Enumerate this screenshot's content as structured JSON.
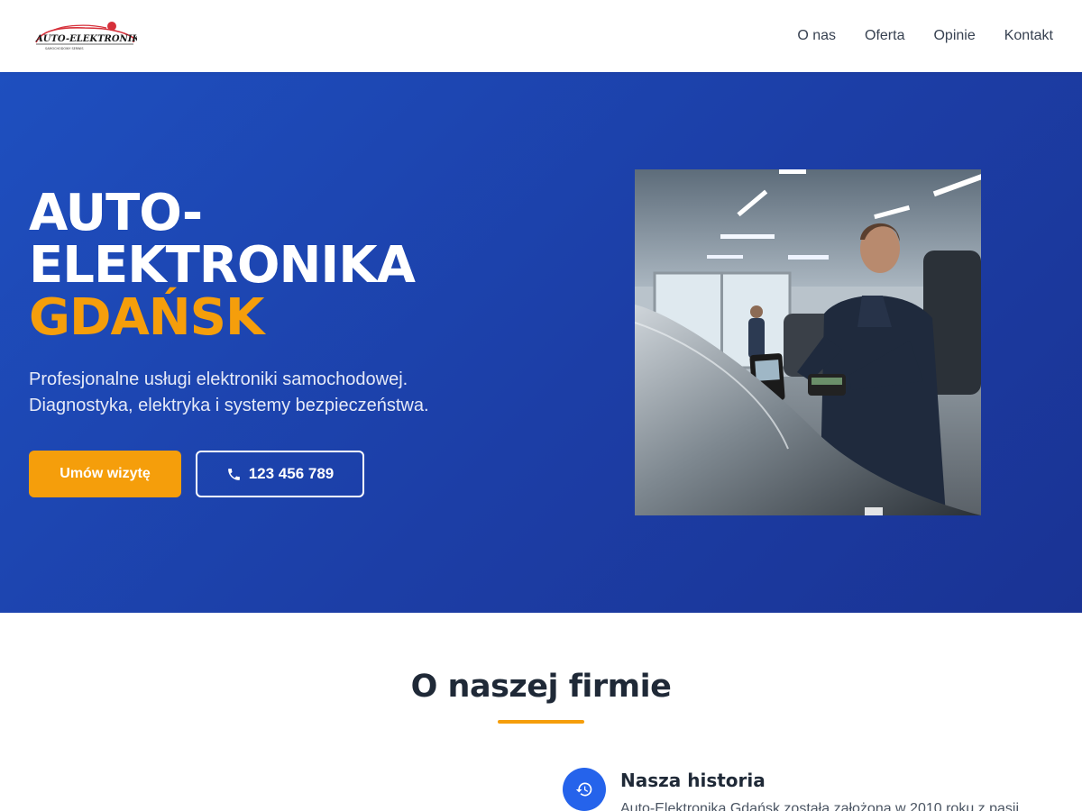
{
  "logo": {
    "brand": "AUTO-ELEKTRONIKA",
    "tagline": "SAMOCHODOWY SERWIS"
  },
  "nav": {
    "items": [
      "O nas",
      "Oferta",
      "Opinie",
      "Kontakt"
    ]
  },
  "hero": {
    "title_line1": "AUTO-",
    "title_line2": "ELEKTRONIKA",
    "title_accent": "GDAŃSK",
    "subtitle": "Profesjonalne usługi elektroniki samochodowej. Diagnostyka, elektryka i systemy bezpieczeństwa.",
    "cta_primary": "Umów wizytę",
    "cta_phone": "123 456 789",
    "image_alt": "phone-icon"
  },
  "about": {
    "title": "O naszej firmie",
    "history_title": "Nasza historia",
    "history_text": "Auto-Elektronika Gdańsk została założona w 2010 roku z pasji"
  },
  "colors": {
    "accent": "#f59e0b",
    "hero_blue": "#1e40af",
    "icon_blue": "#2563eb"
  }
}
